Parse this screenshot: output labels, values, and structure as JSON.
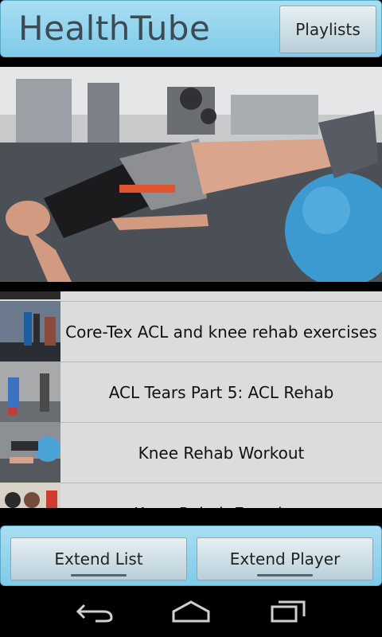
{
  "app": {
    "title": "HealthTube"
  },
  "header": {
    "playlists_label": "Playlists"
  },
  "video": {
    "icon": "video-frame-exercise"
  },
  "list": {
    "items": [
      {
        "label": "Core-Tex ACL and knee rehab exercises"
      },
      {
        "label": "ACL Tears Part 5: ACL Rehab"
      },
      {
        "label": "Knee Rehab Workout"
      },
      {
        "label": "Knee Rehab Exercises"
      }
    ]
  },
  "bottom": {
    "extend_list_label": "Extend List",
    "extend_player_label": "Extend Player"
  },
  "navbar": {
    "icons": [
      "back-icon",
      "home-icon",
      "recent-apps-icon"
    ]
  },
  "colors": {
    "accent": "#86cfeb",
    "button": "#d3e2e8"
  }
}
